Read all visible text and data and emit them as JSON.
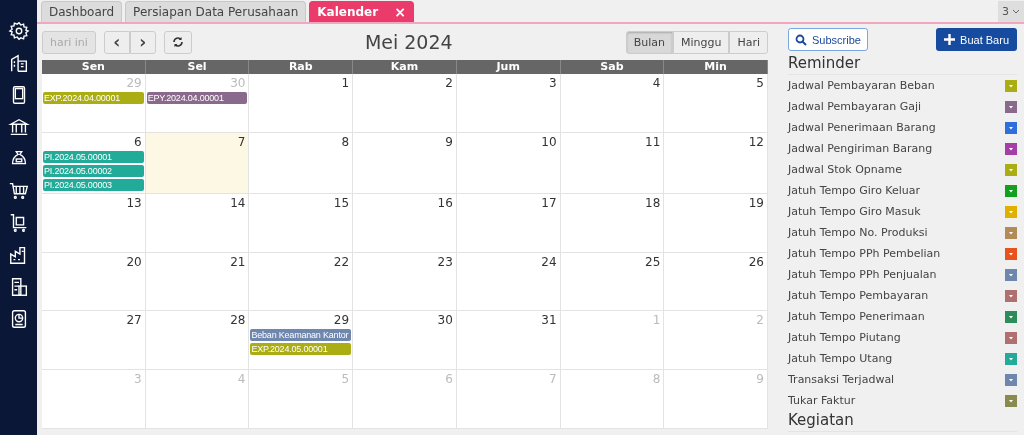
{
  "tabs": [
    {
      "label": "Dashboard",
      "selected": false
    },
    {
      "label": "Persiapan Data Perusahaan",
      "selected": false
    },
    {
      "label": "Kalender",
      "selected": true,
      "close": "×"
    }
  ],
  "tab_overflow": {
    "count": "3"
  },
  "toolbar": {
    "today": {
      "label": "hari ini",
      "disabled": true
    },
    "prev": "‹",
    "next": "›",
    "title": "Mei 2024",
    "views": [
      {
        "label": "Bulan",
        "selected": true
      },
      {
        "label": "Minggu",
        "selected": false
      },
      {
        "label": "Hari",
        "selected": false
      }
    ]
  },
  "calendar": {
    "weekdays": [
      "Sen",
      "Sel",
      "Rab",
      "Kam",
      "Jum",
      "Sab",
      "Min"
    ],
    "weeks": [
      [
        {
          "day": "29",
          "other_month": true,
          "today": false,
          "events": [
            {
              "label": "EXP.2024.04.00001",
              "color": "#aaad14"
            }
          ]
        },
        {
          "day": "30",
          "other_month": true,
          "today": false,
          "events": [
            {
              "label": "EPY.2024.04.00001",
              "color": "#8a6a8c"
            }
          ]
        },
        {
          "day": "1",
          "other_month": false,
          "today": false
        },
        {
          "day": "2",
          "other_month": false,
          "today": false
        },
        {
          "day": "3",
          "other_month": false,
          "today": false
        },
        {
          "day": "4",
          "other_month": false,
          "today": false
        },
        {
          "day": "5",
          "other_month": false,
          "today": false
        }
      ],
      [
        {
          "day": "6",
          "other_month": false,
          "today": false,
          "events": [
            {
              "label": "PI.2024.05.00001",
              "color": "#22ab98"
            },
            {
              "label": "PI.2024.05.00002",
              "color": "#22ab98"
            },
            {
              "label": "PI.2024.05.00003",
              "color": "#22ab98"
            }
          ]
        },
        {
          "day": "7",
          "other_month": false,
          "today": true
        },
        {
          "day": "8",
          "other_month": false,
          "today": false
        },
        {
          "day": "9",
          "other_month": false,
          "today": false
        },
        {
          "day": "10",
          "other_month": false,
          "today": false
        },
        {
          "day": "11",
          "other_month": false,
          "today": false
        },
        {
          "day": "12",
          "other_month": false,
          "today": false
        }
      ],
      [
        {
          "day": "13",
          "other_month": false,
          "today": false
        },
        {
          "day": "14",
          "other_month": false,
          "today": false
        },
        {
          "day": "15",
          "other_month": false,
          "today": false
        },
        {
          "day": "16",
          "other_month": false,
          "today": false
        },
        {
          "day": "17",
          "other_month": false,
          "today": false
        },
        {
          "day": "18",
          "other_month": false,
          "today": false
        },
        {
          "day": "19",
          "other_month": false,
          "today": false
        }
      ],
      [
        {
          "day": "20",
          "other_month": false,
          "today": false
        },
        {
          "day": "21",
          "other_month": false,
          "today": false
        },
        {
          "day": "22",
          "other_month": false,
          "today": false
        },
        {
          "day": "23",
          "other_month": false,
          "today": false
        },
        {
          "day": "24",
          "other_month": false,
          "today": false
        },
        {
          "day": "25",
          "other_month": false,
          "today": false
        },
        {
          "day": "26",
          "other_month": false,
          "today": false
        }
      ],
      [
        {
          "day": "27",
          "other_month": false,
          "today": false
        },
        {
          "day": "28",
          "other_month": false,
          "today": false
        },
        {
          "day": "29",
          "other_month": false,
          "today": false,
          "events": [
            {
              "label": "Beban Keamanan Kantor",
              "color": "#6f86ad"
            },
            {
              "label": "EXP.2024.05.00001",
              "color": "#aaad14"
            }
          ]
        },
        {
          "day": "30",
          "other_month": false,
          "today": false
        },
        {
          "day": "31",
          "other_month": false,
          "today": false
        },
        {
          "day": "1",
          "other_month": true,
          "today": false
        },
        {
          "day": "2",
          "other_month": true,
          "today": false
        }
      ],
      [
        {
          "day": "3",
          "other_month": true,
          "today": false
        },
        {
          "day": "4",
          "other_month": true,
          "today": false
        },
        {
          "day": "5",
          "other_month": true,
          "today": false
        },
        {
          "day": "6",
          "other_month": true,
          "today": false
        },
        {
          "day": "7",
          "other_month": true,
          "today": false
        },
        {
          "day": "8",
          "other_month": true,
          "today": false
        },
        {
          "day": "9",
          "other_month": true,
          "today": false
        }
      ]
    ]
  },
  "panel": {
    "subscribe": "Subscribe",
    "new": "Buat Baru",
    "reminder_title": "Reminder",
    "reminders": [
      {
        "label": "Jadwal Pembayaran Beban",
        "color": "#aaad14"
      },
      {
        "label": "Jadwal Pembayaran Gaji",
        "color": "#8a6a8c"
      },
      {
        "label": "Jadwal Penerimaan Barang",
        "color": "#2f6fdc"
      },
      {
        "label": "Jadwal Pengiriman Barang",
        "color": "#a63ea8"
      },
      {
        "label": "Jadwal Stok Opname",
        "color": "#aaad14"
      },
      {
        "label": "Jatuh Tempo Giro Keluar",
        "color": "#13a01e"
      },
      {
        "label": "Jatuh Tempo Giro Masuk",
        "color": "#e0b000"
      },
      {
        "label": "Jatuh Tempo No. Produksi",
        "color": "#b38b56"
      },
      {
        "label": "Jatuh Tempo PPh Pembelian",
        "color": "#e8521c"
      },
      {
        "label": "Jatuh Tempo PPh Penjualan",
        "color": "#6f86ad"
      },
      {
        "label": "Jatuh Tempo Pembayaran",
        "color": "#b07070"
      },
      {
        "label": "Jatuh Tempo Penerimaan",
        "color": "#2a8d5a"
      },
      {
        "label": "Jatuh Tempo Piutang",
        "color": "#b07070"
      },
      {
        "label": "Jatuh Tempo Utang",
        "color": "#22ab98"
      },
      {
        "label": "Transaksi Terjadwal",
        "color": "#6f86ad"
      },
      {
        "label": "Tukar Faktur",
        "color": "#8a8a4c"
      }
    ],
    "activity_title": "Kegiatan"
  }
}
